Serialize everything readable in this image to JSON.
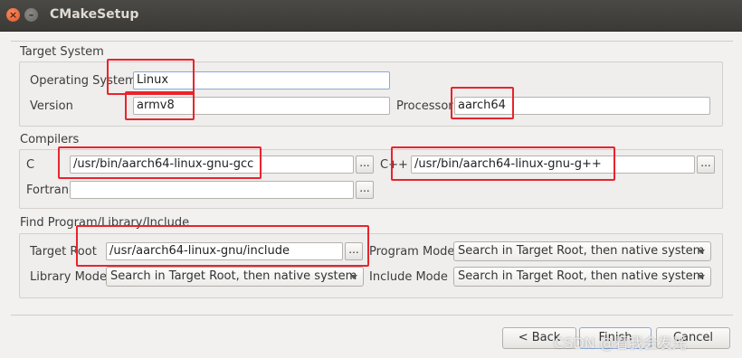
{
  "window": {
    "title": "CMakeSetup",
    "close_glyph": "×",
    "minimize_glyph": "–"
  },
  "target_system": {
    "title": "Target System",
    "os_label": "Operating System",
    "os_value": "Linux",
    "version_label": "Version",
    "version_value": "armv8",
    "processor_label": "Processor",
    "processor_value": "aarch64"
  },
  "compilers": {
    "title": "Compilers",
    "c_label": "C",
    "c_value": "/usr/bin/aarch64-linux-gnu-gcc",
    "cxx_label": "C++",
    "cxx_value": "/usr/bin/aarch64-linux-gnu-g++",
    "fortran_label": "Fortran",
    "fortran_value": "",
    "browse_label": "..."
  },
  "find": {
    "title": "Find Program/Library/Include",
    "target_root_label": "Target Root",
    "target_root_value": "/usr/aarch64-linux-gnu/include",
    "program_mode_label": "Program Mode",
    "program_mode_value": "Search in Target Root, then native system",
    "library_mode_label": "Library Mode",
    "library_mode_value": "Search in Target Root, then native system",
    "include_mode_label": "Include Mode",
    "include_mode_value": "Search in Target Root, then native system",
    "browse_label": "..."
  },
  "buttons": {
    "back": "< Back",
    "finish": "Finish",
    "cancel": "Cancel"
  },
  "watermark": "CSDN @看我会发光",
  "colors": {
    "highlight": "#e8242c",
    "titlebar": "#3b3a36",
    "focus_border": "#8aa9d6"
  }
}
